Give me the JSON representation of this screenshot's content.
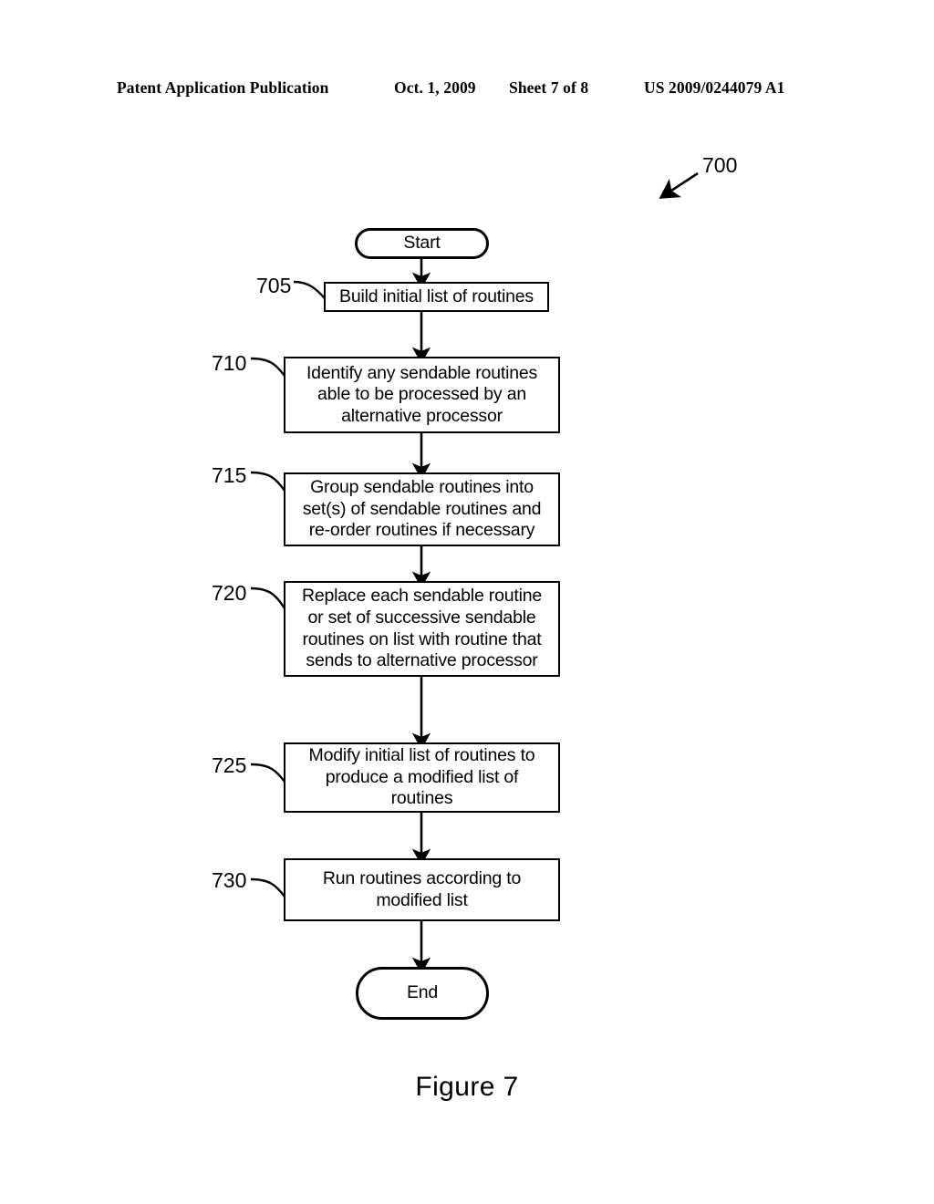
{
  "header": {
    "publication": "Patent Application Publication",
    "date": "Oct. 1, 2009",
    "sheet": "Sheet 7 of 8",
    "patent_number": "US 2009/0244079 A1"
  },
  "figure": {
    "caption": "Figure 7",
    "diagram_reference": "700",
    "type": "flowchart",
    "line_color": "#000000",
    "background_color": "#ffffff"
  },
  "flowchart": {
    "nodes": [
      {
        "id": "start",
        "shape": "terminal",
        "label": "Start",
        "ref": null
      },
      {
        "id": "step-705",
        "shape": "process",
        "label": "Build initial list of routines",
        "ref": "705"
      },
      {
        "id": "step-710",
        "shape": "process",
        "label": "Identify any sendable routines\nable to be processed by an\nalternative processor",
        "ref": "710"
      },
      {
        "id": "step-715",
        "shape": "process",
        "label": "Group sendable routines into\nset(s) of sendable routines and\nre-order routines if necessary",
        "ref": "715"
      },
      {
        "id": "step-720",
        "shape": "process",
        "label": "Replace each sendable routine\nor set of successive sendable\nroutines on list with routine that\nsends to alternative processor",
        "ref": "720"
      },
      {
        "id": "step-725",
        "shape": "process",
        "label": "Modify initial list of routines to\nproduce a modified list of\nroutines",
        "ref": "725"
      },
      {
        "id": "step-730",
        "shape": "process",
        "label": "Run routines according to\nmodified list",
        "ref": "730"
      },
      {
        "id": "end",
        "shape": "terminal",
        "label": "End",
        "ref": null
      }
    ],
    "edges": [
      {
        "from": "start",
        "to": "step-705",
        "style": "arrow"
      },
      {
        "from": "step-705",
        "to": "step-710",
        "style": "arrow"
      },
      {
        "from": "step-710",
        "to": "step-715",
        "style": "arrow"
      },
      {
        "from": "step-715",
        "to": "step-720",
        "style": "arrow"
      },
      {
        "from": "step-720",
        "to": "step-725",
        "style": "arrow"
      },
      {
        "from": "step-725",
        "to": "step-730",
        "style": "arrow"
      },
      {
        "from": "step-730",
        "to": "end",
        "style": "arrow"
      }
    ]
  }
}
